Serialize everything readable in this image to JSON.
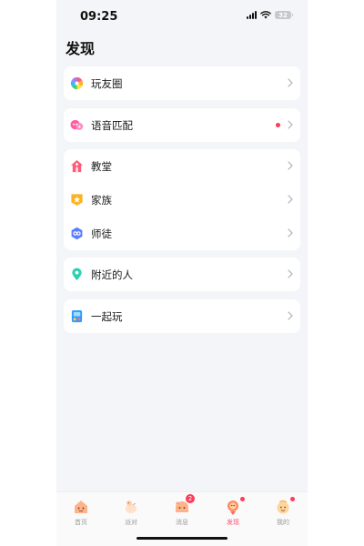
{
  "status_bar": {
    "time": "09:25",
    "battery": "32"
  },
  "page": {
    "title": "发现"
  },
  "menu": {
    "groups": [
      {
        "items": [
          {
            "label": "玩友圈",
            "icon": "colorful-pinwheel-icon"
          }
        ]
      },
      {
        "items": [
          {
            "label": "语音匹配",
            "icon": "voice-match-icon",
            "has_dot": true
          }
        ]
      },
      {
        "items": [
          {
            "label": "教堂",
            "icon": "church-icon"
          },
          {
            "label": "家族",
            "icon": "family-star-icon"
          },
          {
            "label": "师徒",
            "icon": "mentor-hexagon-icon"
          }
        ]
      },
      {
        "items": [
          {
            "label": "附近的人",
            "icon": "location-pin-icon"
          }
        ]
      },
      {
        "items": [
          {
            "label": "一起玩",
            "icon": "play-together-icon"
          }
        ]
      }
    ]
  },
  "tabbar": {
    "tabs": [
      {
        "label": "首页",
        "icon": "home-tab-icon"
      },
      {
        "label": "派对",
        "icon": "party-tab-icon"
      },
      {
        "label": "消息",
        "icon": "message-tab-icon",
        "badge": "2"
      },
      {
        "label": "发现",
        "icon": "discover-tab-icon",
        "active": true,
        "dot": true
      },
      {
        "label": "我的",
        "icon": "profile-tab-icon",
        "dot": true
      }
    ]
  },
  "colors": {
    "accent": "#ff4d6d",
    "badge": "#ff3b58",
    "background": "#f4f5f8"
  }
}
